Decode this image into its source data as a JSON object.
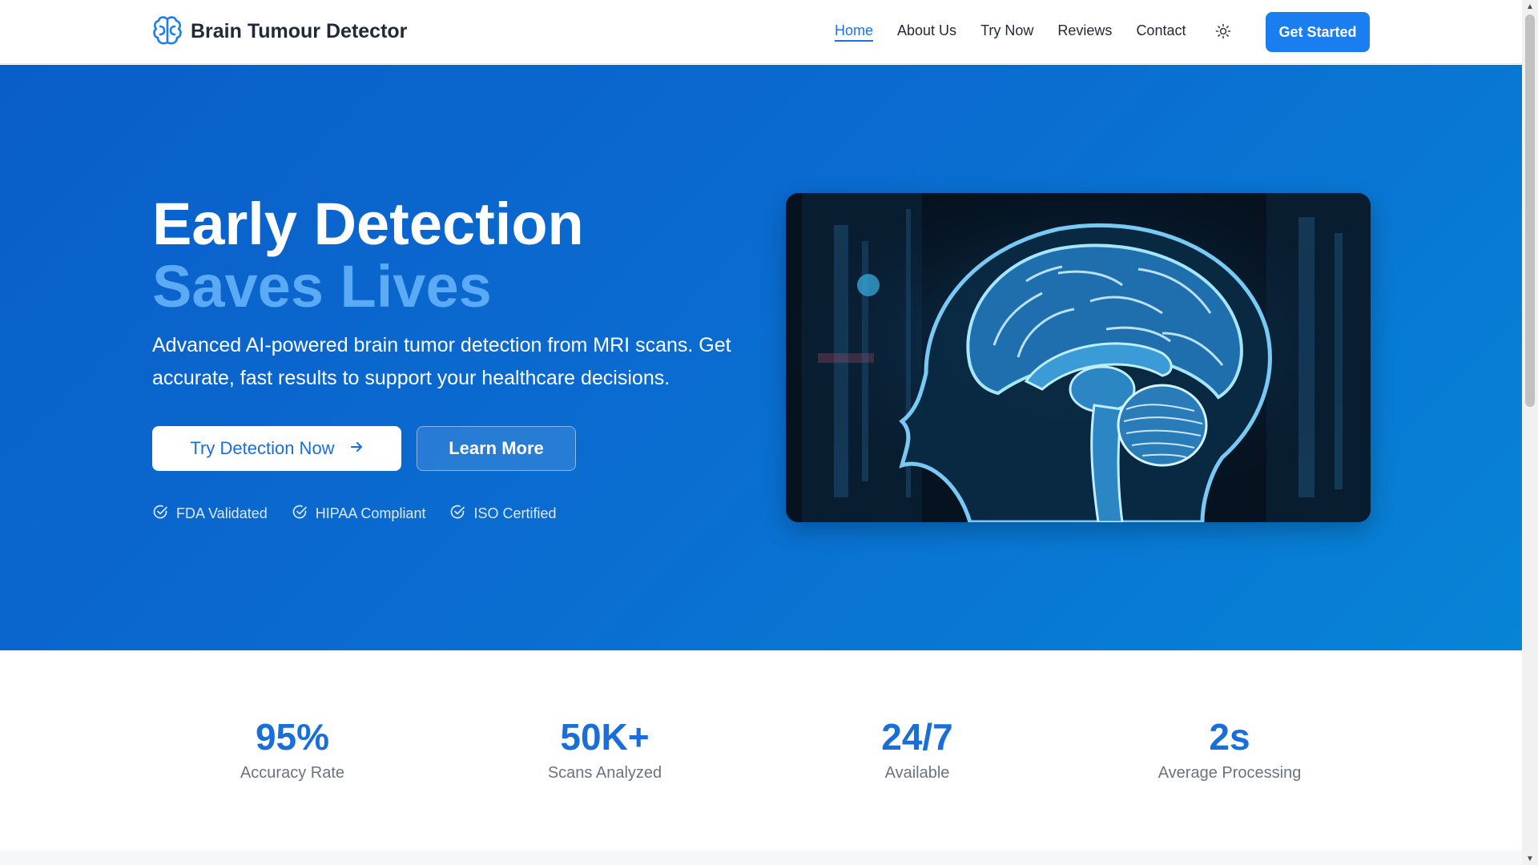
{
  "nav": {
    "brand": "Brain Tumour Detector",
    "links": [
      {
        "label": "Home",
        "active": true
      },
      {
        "label": "About Us"
      },
      {
        "label": "Try Now"
      },
      {
        "label": "Reviews"
      },
      {
        "label": "Contact"
      }
    ],
    "cta": "Get Started",
    "theme_icon": "sun-icon"
  },
  "hero": {
    "title_line1": "Early Detection",
    "title_line2": "Saves Lives",
    "description": "Advanced AI-powered brain tumor detection from MRI scans. Get accurate, fast results to support your healthcare decisions.",
    "primary_button": "Try Detection Now",
    "secondary_button": "Learn More",
    "badges": [
      "FDA Validated",
      "HIPAA Compliant",
      "ISO Certified"
    ]
  },
  "stats": [
    {
      "value": "95%",
      "label": "Accuracy Rate"
    },
    {
      "value": "50K+",
      "label": "Scans Analyzed"
    },
    {
      "value": "24/7",
      "label": "Available"
    },
    {
      "value": "2s",
      "label": "Average Processing"
    }
  ],
  "colors": {
    "accent": "#1a7ef0",
    "hero_bg": "#0a6bd0",
    "title_highlight": "#5aaaf6",
    "stat_value": "#1a6ed8"
  }
}
